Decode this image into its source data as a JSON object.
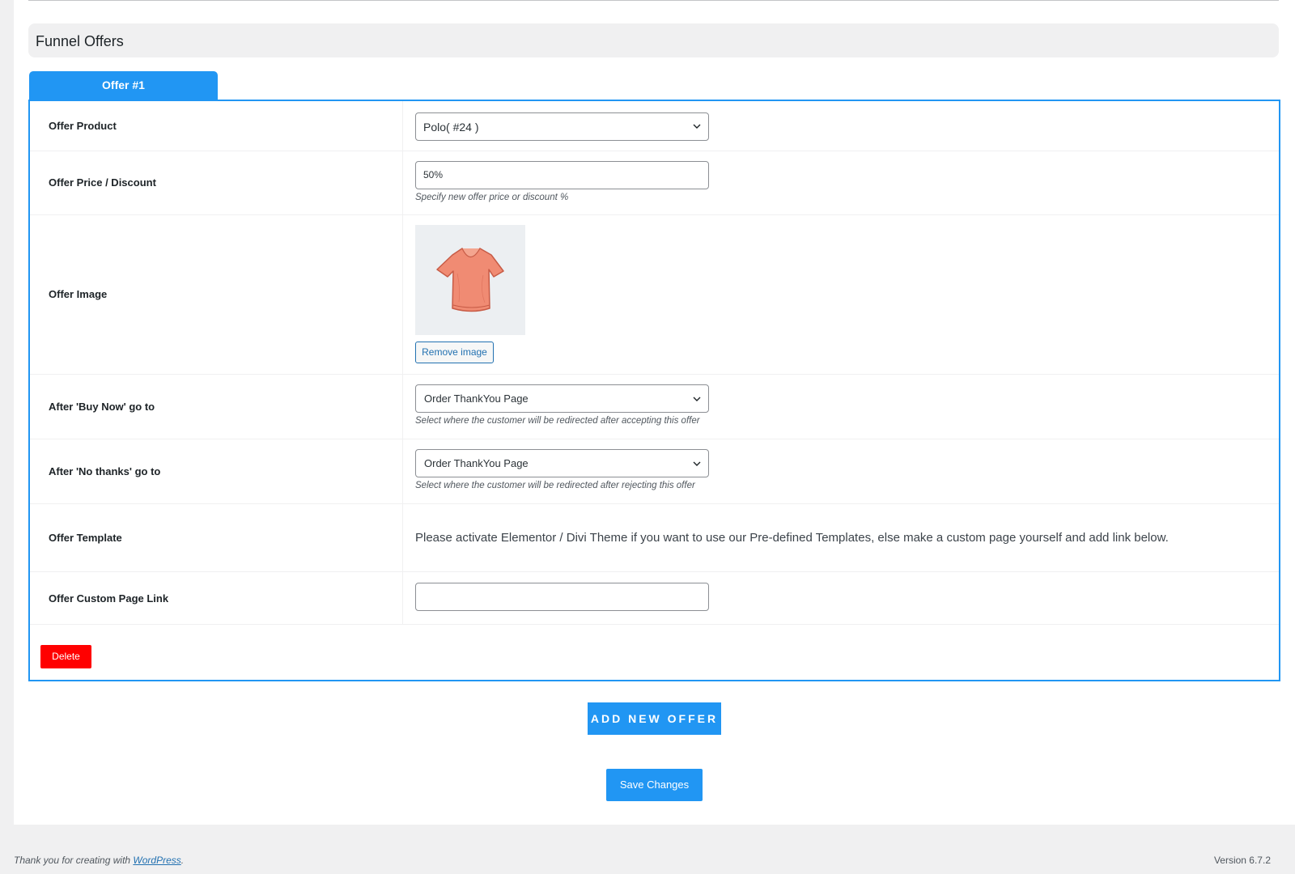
{
  "section": {
    "title": "Funnel Offers"
  },
  "tab": {
    "label": "Offer #1"
  },
  "rows": {
    "product": {
      "label": "Offer Product",
      "value": "Polo( #24 )"
    },
    "price": {
      "label": "Offer Price / Discount",
      "value": "50%",
      "help": "Specify new offer price or discount %"
    },
    "image": {
      "label": "Offer Image",
      "remove_label": "Remove image",
      "icon": "t-shirt-image"
    },
    "buy_now": {
      "label": "After 'Buy Now' go to",
      "value": "Order ThankYou Page",
      "help": "Select where the customer will be redirected after accepting this offer"
    },
    "no_thanks": {
      "label": "After 'No thanks' go to",
      "value": "Order ThankYou Page",
      "help": "Select where the customer will be redirected after rejecting this offer"
    },
    "template": {
      "label": "Offer Template",
      "note": "Please activate Elementor / Divi Theme if you want to use our Pre-defined Templates, else make a custom page yourself and add link below."
    },
    "custom_link": {
      "label": "Offer Custom Page Link",
      "value": ""
    }
  },
  "buttons": {
    "delete": "Delete",
    "add_offer": "ADD NEW OFFER",
    "save": "Save Changes"
  },
  "footer": {
    "thanks_prefix": "Thank you for creating with ",
    "wordpress_link": "WordPress",
    "thanks_suffix": ".",
    "version": "Version 6.7.2"
  },
  "colors": {
    "accent": "#2196f3",
    "danger": "#ff0000",
    "link": "#2271b1",
    "shirt": "#f08b73"
  }
}
